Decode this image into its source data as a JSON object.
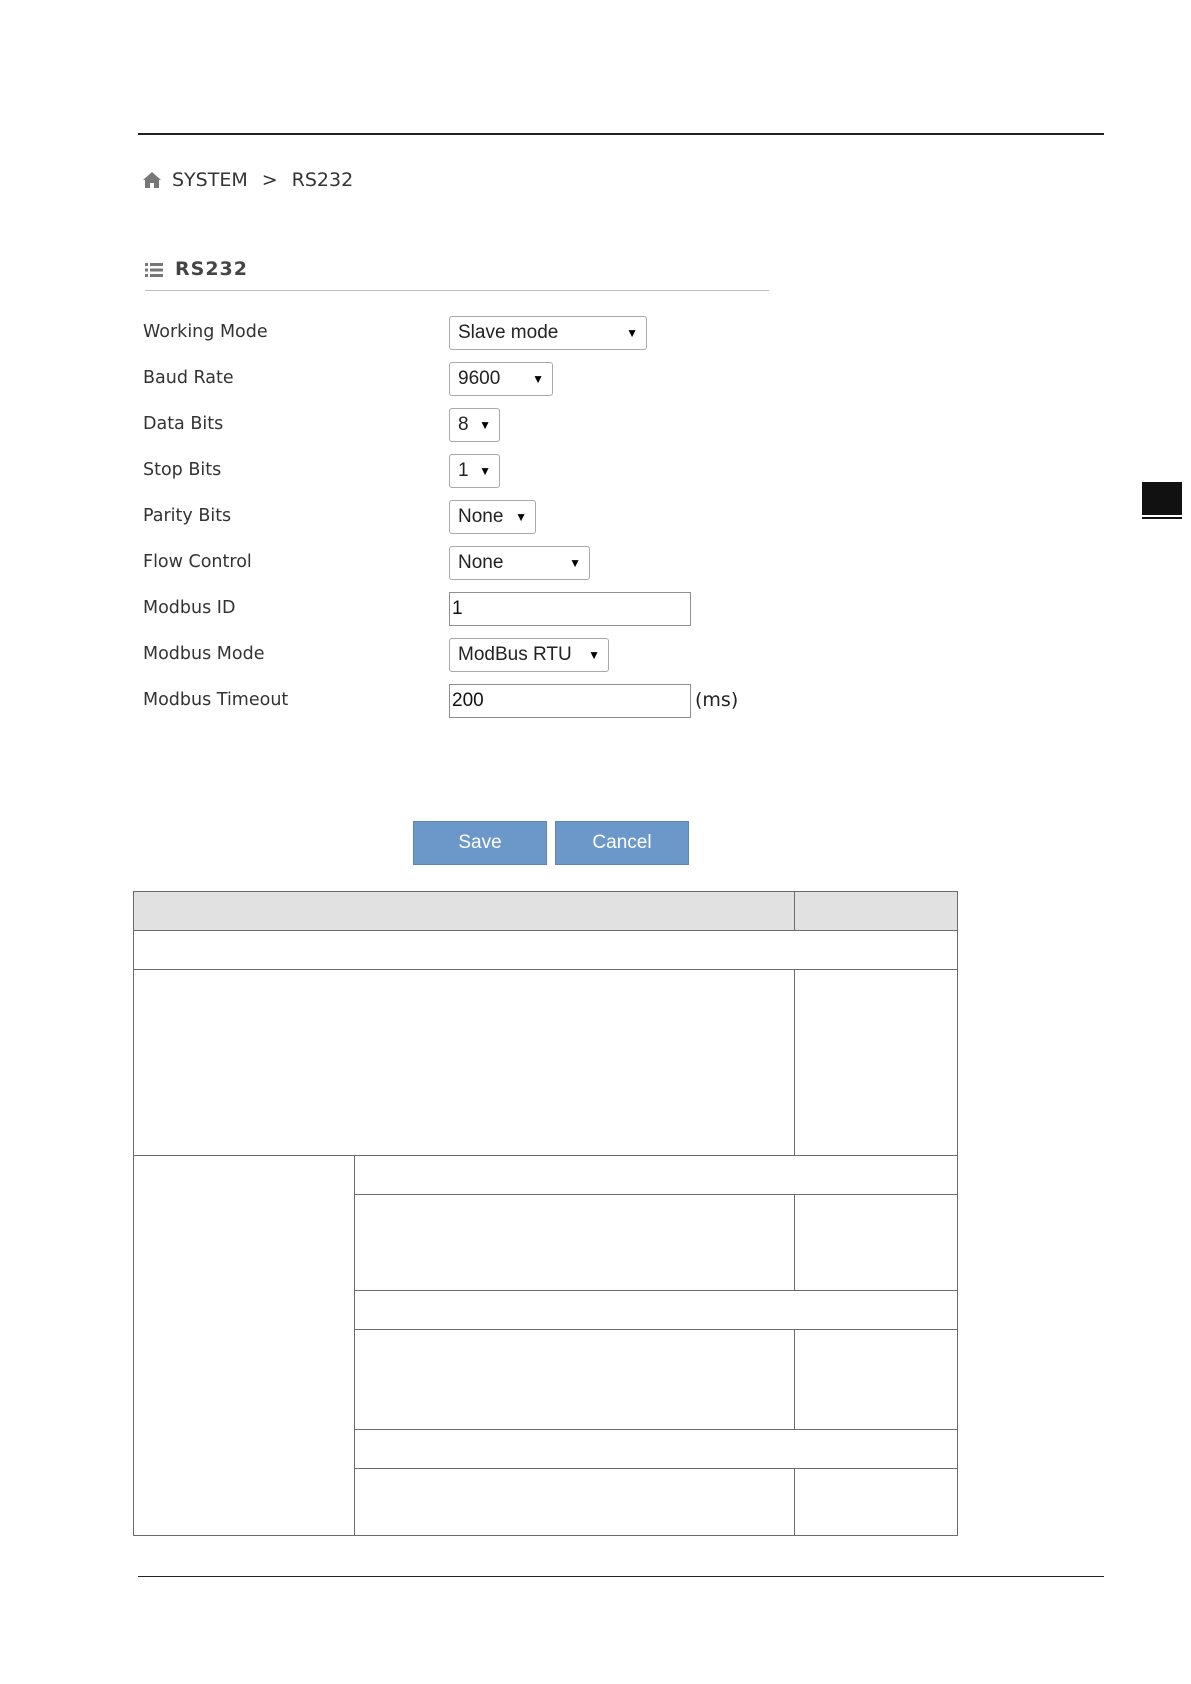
{
  "breadcrumb": {
    "items": [
      "SYSTEM",
      ">",
      "RS232"
    ]
  },
  "panel": {
    "title": "RS232"
  },
  "form": {
    "working_mode": {
      "label": "Working Mode",
      "value": "Slave mode"
    },
    "baud_rate": {
      "label": "Baud Rate",
      "value": "9600"
    },
    "data_bits": {
      "label": "Data Bits",
      "value": "8"
    },
    "stop_bits": {
      "label": "Stop Bits",
      "value": "1"
    },
    "parity_bits": {
      "label": "Parity Bits",
      "value": "None"
    },
    "flow_control": {
      "label": "Flow Control",
      "value": "None"
    },
    "modbus_id": {
      "label": "Modbus ID",
      "value": "1"
    },
    "modbus_mode": {
      "label": "Modbus Mode",
      "value": "ModBus RTU"
    },
    "modbus_timeout": {
      "label": "Modbus Timeout",
      "value": "200",
      "unit": "(ms)"
    }
  },
  "buttons": {
    "save": "Save",
    "cancel": "Cancel"
  },
  "icons": {
    "breadcrumb": "home-icon",
    "panel": "list-icon",
    "dropdown": "caret-down-icon"
  },
  "colors": {
    "button_bg": "#6c97c9",
    "table_header_bg": "#e1e1e1"
  }
}
